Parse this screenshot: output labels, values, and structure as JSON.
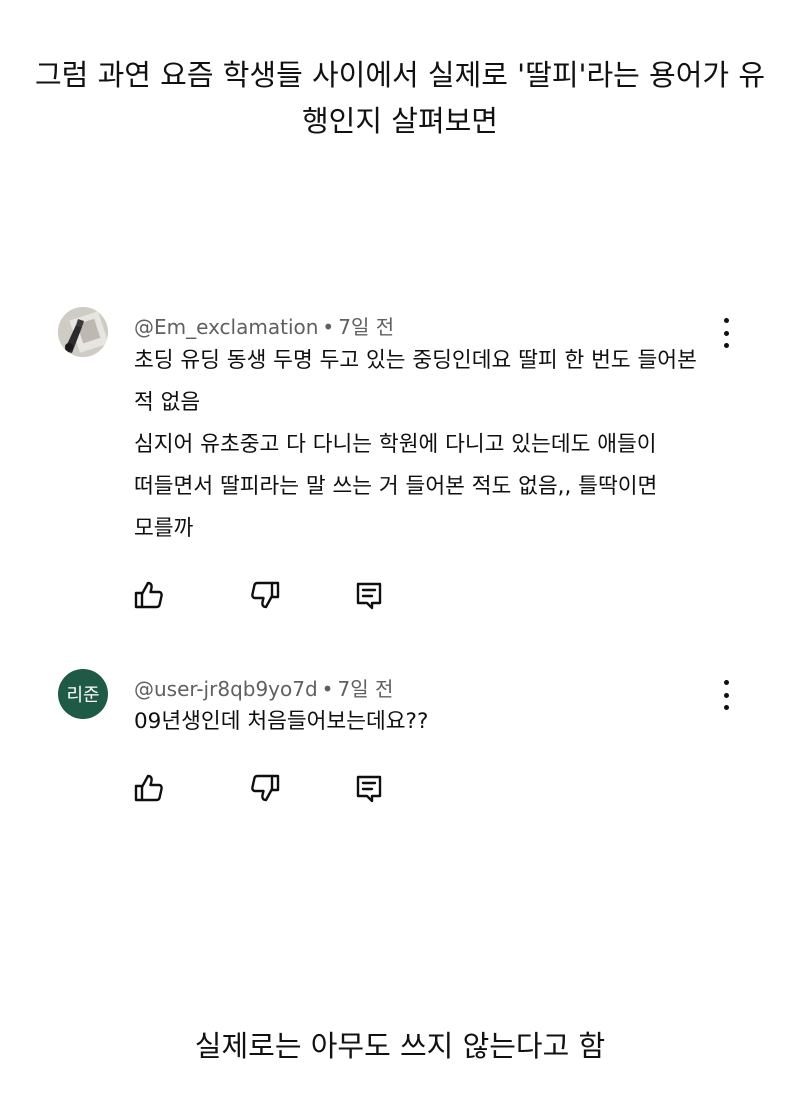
{
  "caption_top": {
    "line1": "그럼 과연 요즘 학생들 사이에서 실제로 '딸피'라는 용어가 유",
    "line2": "행인지 살펴보면"
  },
  "comments": [
    {
      "avatar_type": "photo",
      "handle": "@Em_exclamation",
      "time": "7일 전",
      "lines": [
        "초딩 유딩 동생 두명 두고 있는 중딩인데요 딸피 한 번도 들어본",
        "적 없음",
        "심지어 유초중고 다 다니는 학원에 다니고 있는데도 애들이",
        "떠들면서 딸피라는 말 쓰는 거 들어본 적도 없음,, 틀딱이면",
        "모를까"
      ]
    },
    {
      "avatar_type": "initials",
      "avatar_initials": "리준",
      "avatar_color": "#1f5a47",
      "handle": "@user-jr8qb9yo7d",
      "time": "7일 전",
      "lines": [
        "09년생인데 처음들어보는데요??"
      ]
    }
  ],
  "meta_separator": "•",
  "icons": [
    "thumbs-up-icon",
    "thumbs-down-icon",
    "reply-icon",
    "more-vert-icon"
  ],
  "caption_bottom": "실제로는 아무도 쓰지 않는다고 함"
}
